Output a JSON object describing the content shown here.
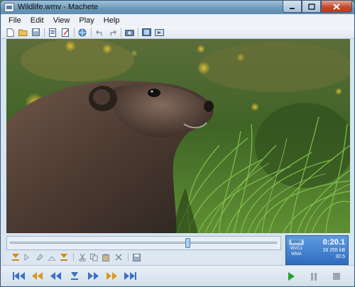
{
  "window": {
    "title": "Wildlife.wmv - Machete"
  },
  "menu": [
    {
      "label": "File"
    },
    {
      "label": "Edit"
    },
    {
      "label": "View"
    },
    {
      "label": "Play"
    },
    {
      "label": "Help"
    }
  ],
  "playback": {
    "position_fraction": 0.67
  },
  "status": {
    "format_badge": "WMV",
    "video_codec": "WVC1",
    "audio_codec": "WMA",
    "time": "0:20.1",
    "kb": "28 255 kB",
    "fps": "30.5"
  }
}
